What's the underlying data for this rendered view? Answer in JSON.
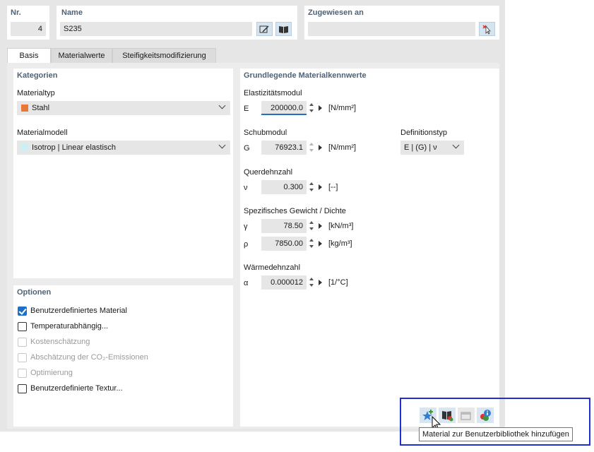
{
  "header": {
    "nr": {
      "label": "Nr.",
      "value": "4"
    },
    "name": {
      "label": "Name",
      "value": "S235"
    },
    "assigned": {
      "label": "Zugewiesen an",
      "value": ""
    }
  },
  "tabs": [
    {
      "label": "Basis",
      "active": true
    },
    {
      "label": "Materialwerte",
      "active": false
    },
    {
      "label": "Steifigkeitsmodifizierung",
      "active": false
    }
  ],
  "categories": {
    "title": "Kategorien",
    "material_type": {
      "label": "Materialtyp",
      "value": "Stahl",
      "color": "#e8783a"
    },
    "material_model": {
      "label": "Materialmodell",
      "value": "Isotrop | Linear elastisch",
      "color": "#c8f0f5"
    }
  },
  "options": {
    "title": "Optionen",
    "items": [
      {
        "label": "Benutzerdefiniertes Material",
        "checked": true,
        "enabled": true
      },
      {
        "label": "Temperaturabhängig...",
        "checked": false,
        "enabled": true
      },
      {
        "label": "Kostenschätzung",
        "checked": false,
        "enabled": false
      },
      {
        "label": "Abschätzung der CO₂-Emissionen",
        "checked": false,
        "enabled": false
      },
      {
        "label": "Optimierung",
        "checked": false,
        "enabled": false
      },
      {
        "label": "Benutzerdefinierte Textur...",
        "checked": false,
        "enabled": true
      }
    ]
  },
  "props": {
    "title": "Grundlegende Materialkennwerte",
    "e_modulus": {
      "label": "Elastizitätsmodul",
      "symbol": "E",
      "value": "200000.0",
      "unit": "[N/mm²]"
    },
    "shear_modulus": {
      "label": "Schubmodul",
      "symbol": "G",
      "value": "76923.1",
      "unit": "[N/mm²]"
    },
    "definition_type": {
      "label": "Definitionstyp",
      "value": "E | (G) | ν"
    },
    "poisson": {
      "label": "Querdehnzahl",
      "symbol": "ν",
      "value": "0.300",
      "unit": "[--]"
    },
    "density": {
      "label": "Spezifisches Gewicht / Dichte",
      "gamma": {
        "symbol": "γ",
        "value": "78.50",
        "unit": "[kN/m³]"
      },
      "rho": {
        "symbol": "ρ",
        "value": "7850.00",
        "unit": "[kg/m³]"
      }
    },
    "thermal": {
      "label": "Wärmedehnzahl",
      "symbol": "α",
      "value": "0.000012",
      "unit": "[1/°C]"
    }
  },
  "toolbar": {
    "tooltip": "Material zur Benutzerbibliothek hinzufügen"
  }
}
